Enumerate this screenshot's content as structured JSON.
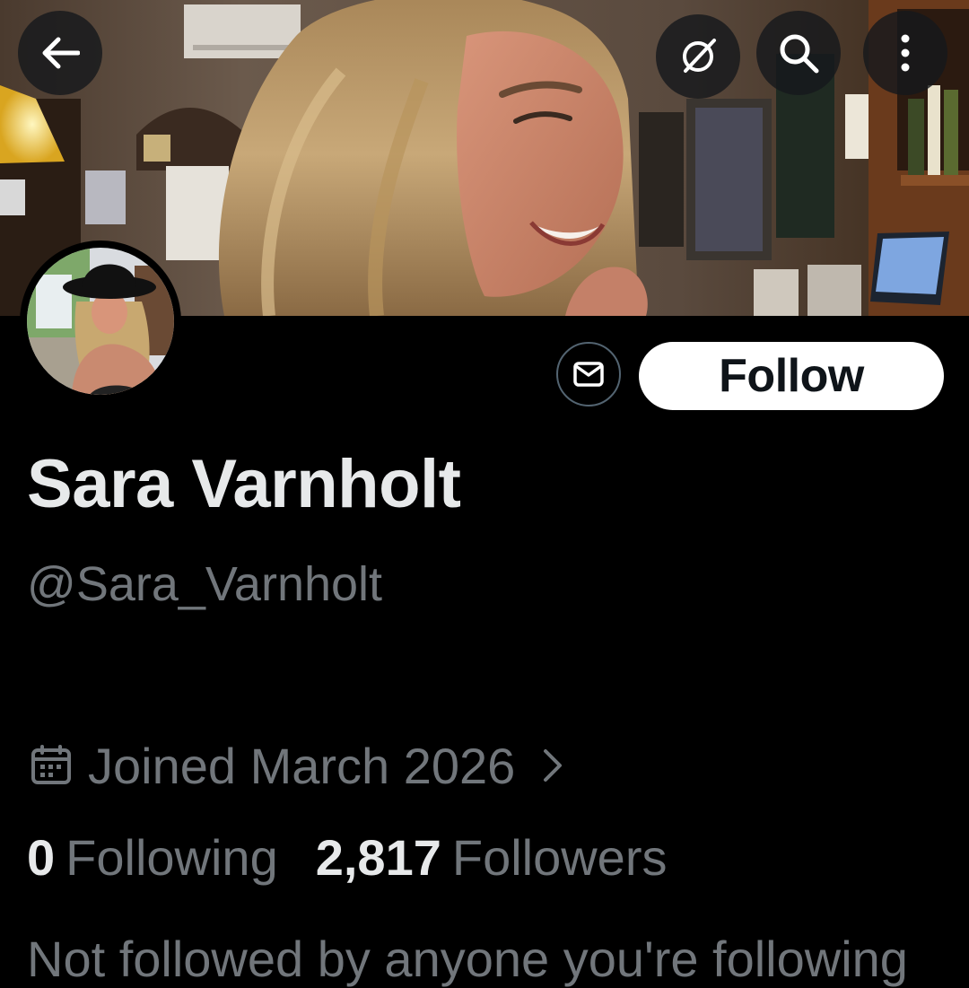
{
  "profile": {
    "display_name": "Sara Varnholt",
    "handle": "@Sara_Varnholt",
    "joined": "Joined March 2026",
    "following_count": "0",
    "following_label": "Following",
    "followers_count": "2,817",
    "followers_label": "Followers",
    "followed_by_note": "Not followed by anyone you're following"
  },
  "actions": {
    "follow_label": "Follow"
  },
  "icons": {
    "back": "arrow-left-icon",
    "grok": "grok-icon",
    "search": "search-icon",
    "more": "more-vertical-icon",
    "message": "envelope-icon",
    "calendar": "calendar-icon",
    "chevron": "chevron-right-icon"
  },
  "colors": {
    "background": "#000000",
    "primary_text": "#e7e9ea",
    "secondary_text": "#71767b",
    "follow_button_bg": "#ffffff",
    "follow_button_text": "#0f1419",
    "border": "#536471"
  }
}
